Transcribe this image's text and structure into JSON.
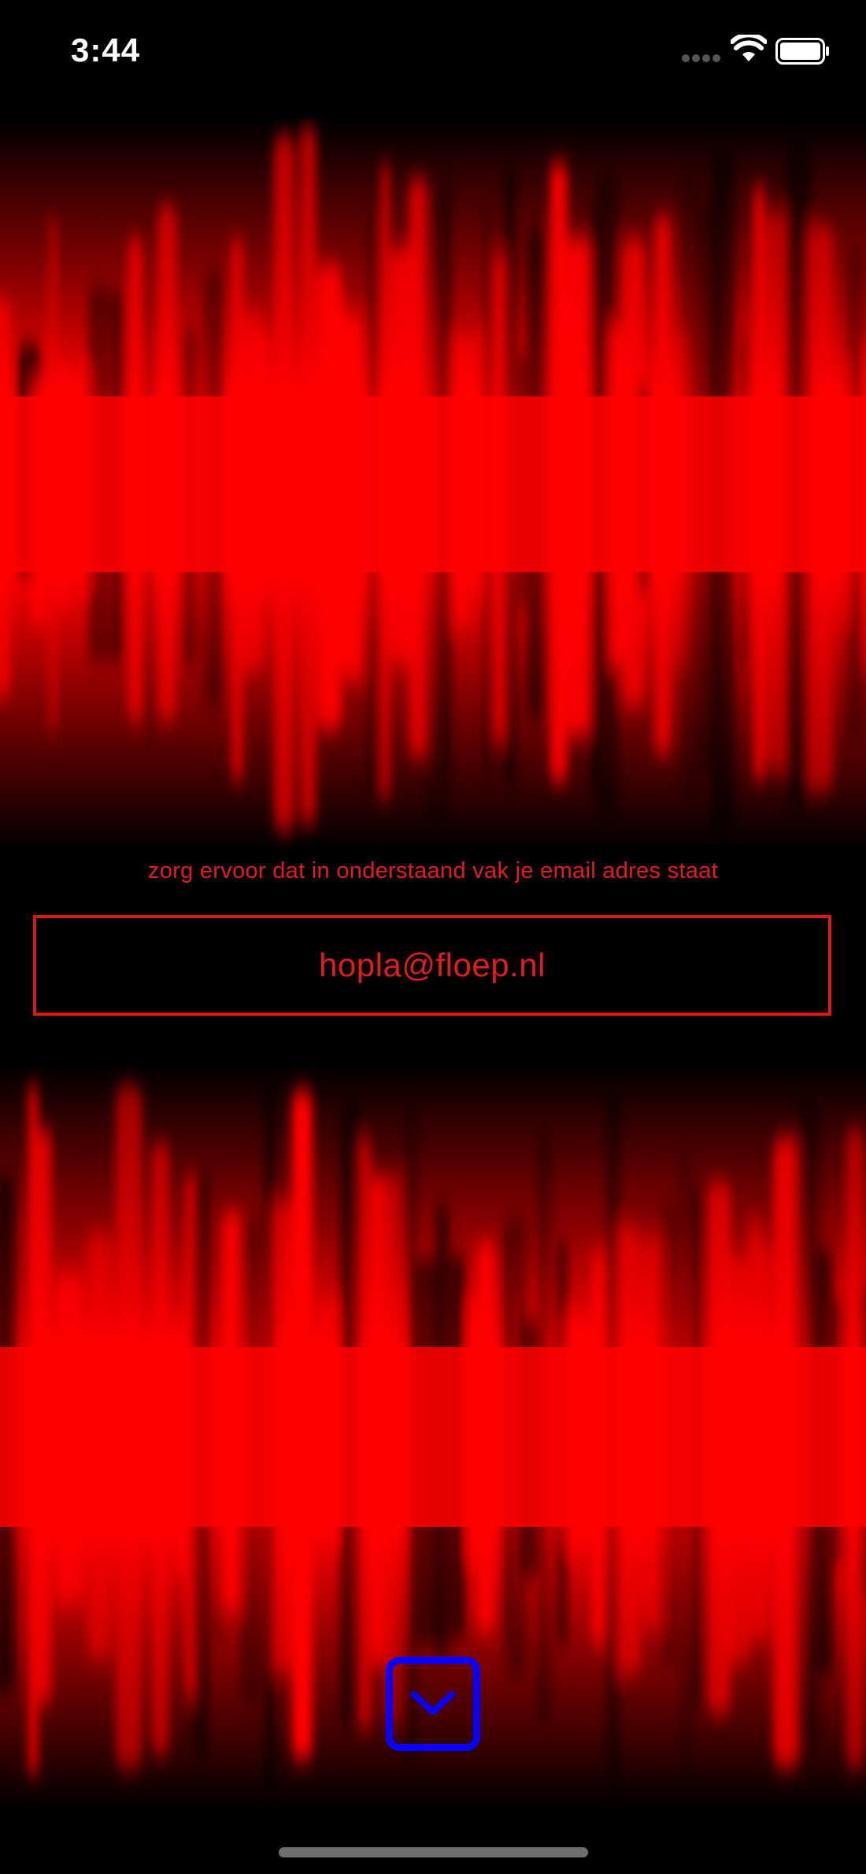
{
  "status_bar": {
    "time": "3:44",
    "icons": [
      "signal-dots-icon",
      "wifi-icon",
      "battery-icon"
    ]
  },
  "form": {
    "instruction": "zorg ervoor dat in onderstaand vak je email adres staat",
    "email_value": "hopla@floep.nl"
  },
  "controls": {
    "down_button_icon": "chevron-down-icon"
  },
  "colors": {
    "background": "#000000",
    "accent_red": "#ff0000",
    "text_red": "#e31b1b",
    "button_blue": "#0a00ff"
  }
}
